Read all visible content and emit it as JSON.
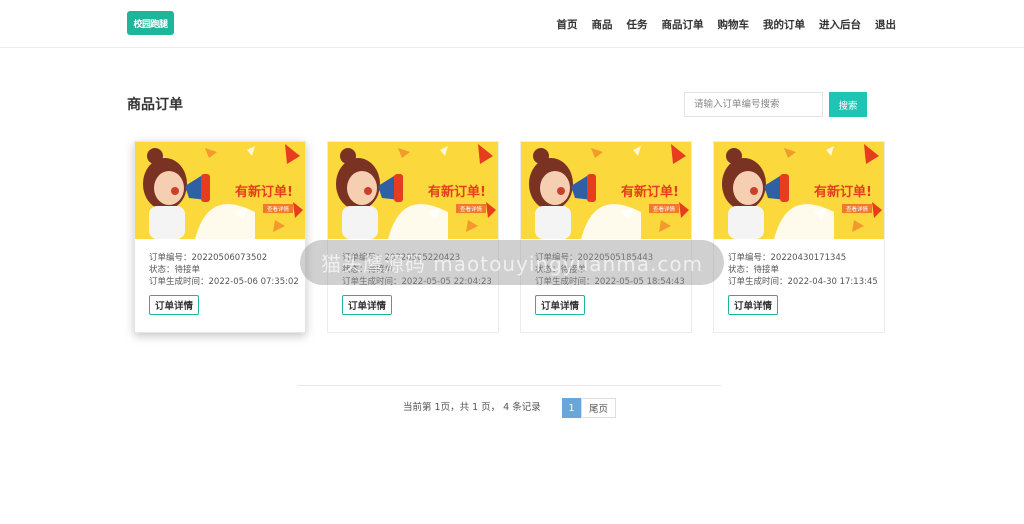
{
  "header": {
    "logo_text": "校园跑腿",
    "nav": [
      {
        "label": "首页"
      },
      {
        "label": "商品"
      },
      {
        "label": "任务"
      },
      {
        "label": "商品订单"
      },
      {
        "label": "购物车"
      },
      {
        "label": "我的订单"
      },
      {
        "label": "进入后台"
      },
      {
        "label": "退出"
      }
    ]
  },
  "main": {
    "title": "商品订单",
    "search": {
      "placeholder": "请输入订单编号搜索",
      "button_label": "搜索"
    },
    "orders": [
      {
        "order_no_label": "订单编号：20220506073502",
        "status_label": "状态：待接单",
        "created_label": "订单生成时间：2022-05-06 07:35:02",
        "detail_label": "订单详情",
        "banner_text": "有新订单!",
        "banner_sub": "查看详情"
      },
      {
        "order_no_label": "订单编号：20220505220423",
        "status_label": "状态：待接单",
        "created_label": "订单生成时间：2022-05-05 22:04:23",
        "detail_label": "订单详情",
        "banner_text": "有新订单!",
        "banner_sub": "查看详情"
      },
      {
        "order_no_label": "订单编号：20220505185443",
        "status_label": "状态：待接单",
        "created_label": "订单生成时间：2022-05-05 18:54:43",
        "detail_label": "订单详情",
        "banner_text": "有新订单!",
        "banner_sub": "查看详情"
      },
      {
        "order_no_label": "订单编号：20220430171345",
        "status_label": "状态：待接单",
        "created_label": "订单生成时间：2022-04-30 17:13:45",
        "detail_label": "订单详情",
        "banner_text": "有新订单!",
        "banner_sub": "查看详情"
      }
    ]
  },
  "watermark": {
    "text": "猫头鹰源码  maotouyingyuanma.com"
  },
  "pagination": {
    "summary": "当前第 1页，共 1 页， 4 条记录",
    "current_page": "1",
    "last_label": "尾页"
  },
  "colors": {
    "accent": "#1fb59a",
    "search_button": "#1fc4b4",
    "banner_bg": "#fbd83c",
    "banner_text": "#e53d1d",
    "page_active": "#6aa7d8"
  }
}
